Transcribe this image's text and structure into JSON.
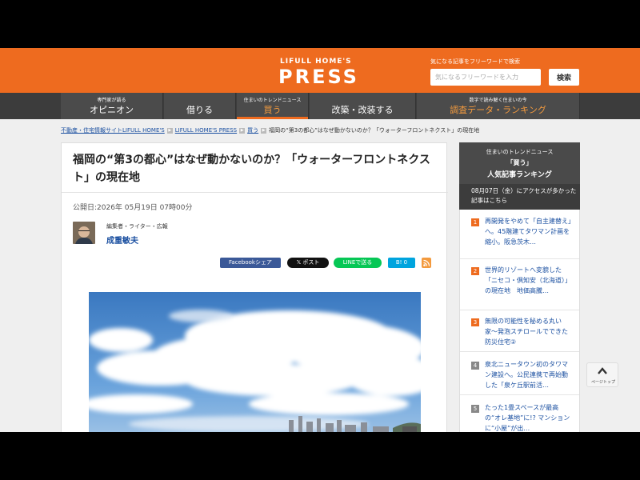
{
  "header": {
    "logo_top": "LIFULL HOME'S",
    "logo_main": "PRESS",
    "search_caption": "気になる記事をフリーワードで検索",
    "search_placeholder": "気になるフリーワードを入力",
    "search_button": "検索"
  },
  "nav": [
    {
      "sub": "専門家が語る",
      "label": "オピニオン"
    },
    {
      "sub": "",
      "label": "借りる"
    },
    {
      "sub": "住まいのトレンドニュース",
      "label": "買う"
    },
    {
      "sub": "",
      "label": "改築・改装する"
    },
    {
      "sub": "数字で読み解く住まいの今",
      "label": "調査データ・ランキング"
    }
  ],
  "breadcrumb": {
    "home": "不動産・住宅情報サイトLIFULL HOME'S",
    "press": "LIFULL HOME'S PRESS",
    "category": "買う",
    "current": "福岡の“第3の都心”はなぜ動かないのか？「ウォーターフロントネクスト」の現在地"
  },
  "article": {
    "title": "福岡の“第3の都心”はなぜ動かないのか？「ウォーターフロントネクスト」の現在地",
    "published": "公開日:2026年 05月19日 07時00分",
    "author_role": "編集者・ライター・広報",
    "author_name": "成重敏夫"
  },
  "share": {
    "facebook": "Facebookシェア",
    "x": "𝕏 ポスト",
    "line": "LINEで送る",
    "hatena": "B! 0"
  },
  "sidebar": {
    "head_sub": "住まいのトレンドニュース",
    "head_category": "「買う」",
    "head_title": "人気記事ランキング",
    "note": "08月07日（金）にアクセスが多かった記事はこちら",
    "items": [
      {
        "rank": "1",
        "text": "再開発をやめて「自主建替え」へ。45階建てタワマン計画を縮小。阪急茨木…"
      },
      {
        "rank": "2",
        "text": "世界的リゾートへ変貌した「ニセコ・倶知安（北海道）」の現在地　地価高騰…"
      },
      {
        "rank": "3",
        "text": "無限の可能性を秘める丸い家〜発泡スチロールでできた防災住宅②"
      },
      {
        "rank": "4",
        "text": "泉北ニュータウン初のタワマン建設へ。公民連携で再始動した「泉ケ丘駅前活…"
      },
      {
        "rank": "5",
        "text": "たった1畳スペースが最高の“オレ基地”に!? マンションに“小屋”が出…"
      }
    ]
  },
  "pagetop_label": "ページトップ",
  "colors": {
    "brand_orange": "#ee6b1f",
    "nav_dark": "#3c3c3c",
    "link_blue": "#1a4fa0"
  }
}
